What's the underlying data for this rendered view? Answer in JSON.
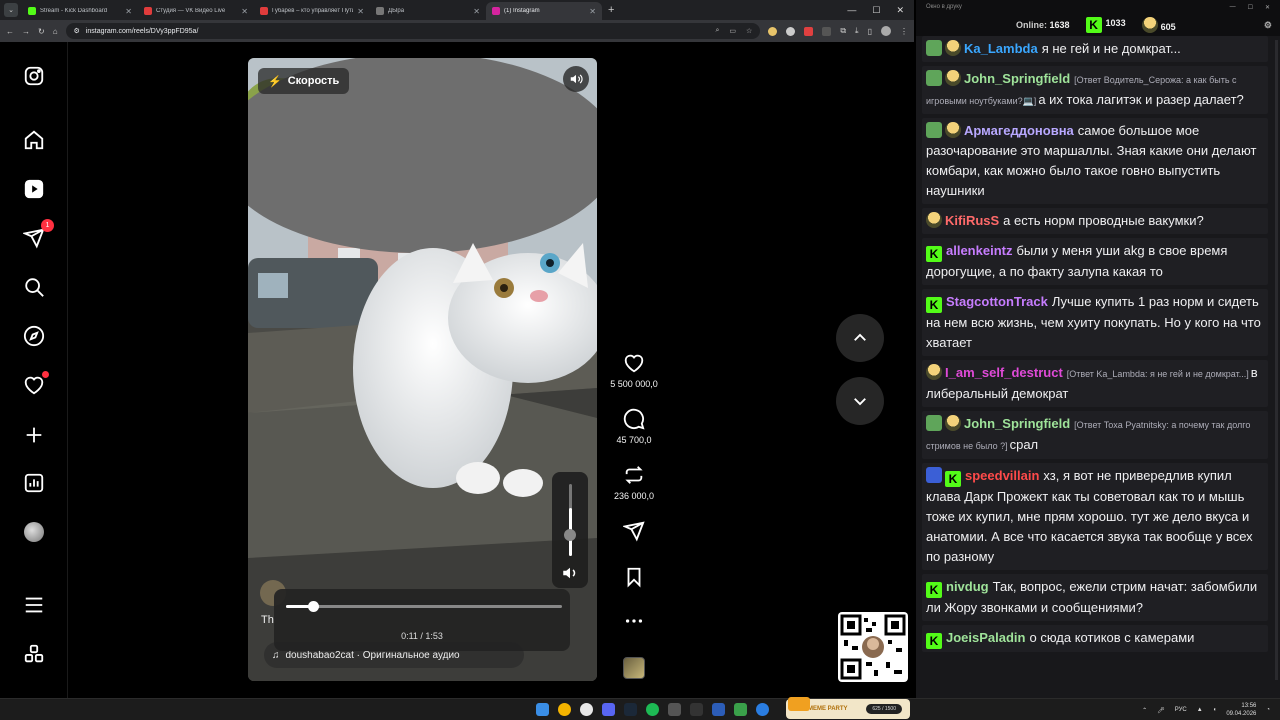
{
  "browser": {
    "tabs": [
      {
        "title": "Stream - Kick Dashboard",
        "color": "#53fc18",
        "active": false
      },
      {
        "title": "Студия — VK Видео Live",
        "color": "#e03c3c",
        "active": false
      },
      {
        "title": "Губарев – кто управляет Пути",
        "color": "#e03c3c",
        "active": false
      },
      {
        "title": "ДЫра",
        "color": "#777777",
        "active": false
      },
      {
        "title": "(1) Instagram",
        "color": "#d6249f",
        "active": true
      }
    ],
    "url": "instagram.com/reels/DVy3ppFD95a/"
  },
  "reel": {
    "speed_label": "Скорость",
    "time": "0:11 / 1:53",
    "progress": 0.097,
    "volume": 0.66,
    "caption_fragment": "Th",
    "audio": "doushabao2cat · Оригинальное аудио",
    "likes": "5 500 000,0",
    "comments": "45 700,0",
    "reposts": "236 000,0"
  },
  "sidebar": {
    "notifications_badge": "1"
  },
  "chat": {
    "title": "Окно в друку",
    "online_label": "Online:",
    "online": "1638",
    "kick_count": "1033",
    "emote_count": "605",
    "messages": [
      {
        "user": "Ka_Lambda",
        "color": "#3aa7ff",
        "text": "я не гей и не домкрат...",
        "reply": "",
        "badges": [
          "sub",
          "emote"
        ]
      },
      {
        "user": "John_Springfield",
        "color": "#9fe39a",
        "text": "а их тока лагитэк и разер далает?",
        "reply": "[Ответ Водитель_Серожа: а как быть с игровыми ноутбуками?💻]",
        "badges": [
          "sub",
          "emote"
        ]
      },
      {
        "user": "Армагеддоновна",
        "color": "#b8a8ff",
        "text": "самое большое мое разочарование это маршаллы. Зная какие они делают комбари, как можно было такое говно выпустить наушники",
        "reply": "",
        "badges": [
          "sub",
          "emote"
        ]
      },
      {
        "user": "KifiRusS",
        "color": "#ff6a6a",
        "text": "а есть норм проводные вакумки?",
        "reply": "",
        "badges": [
          "emote"
        ]
      },
      {
        "user": "allenkeintz",
        "color": "#c77dff",
        "text": "были у меня уши akg в свое время дорогущие, а по факту залупа какая то",
        "reply": "",
        "badges": [
          "kick"
        ]
      },
      {
        "user": "StagcottonTrack",
        "color": "#c77dff",
        "text": "Лучше купить 1 раз норм и сидеть на нем всю жизнь, чем хуиту покупать. Но у кого на что хватает",
        "reply": "",
        "badges": [
          "kick"
        ]
      },
      {
        "user": "I_am_self_destruct",
        "color": "#e04ad8",
        "text": "в либеральный демократ",
        "reply": "[Ответ Ka_Lambda: я не гей и не домкрат...]",
        "badges": [
          "emote"
        ]
      },
      {
        "user": "John_Springfield",
        "color": "#9fe39a",
        "text": "срал",
        "reply": "[Ответ Toxa Pyatnitsky: а почему так долго стримов не было ?]",
        "badges": [
          "sub",
          "emote"
        ]
      },
      {
        "user": "speedvillain",
        "color": "#ff4a4a",
        "text": "хз, я вот не привередлив купил клава Дарк Прожект как ты советовал как то и мышь тоже их купил, мне прям хорошо. тут же дело вкуса и анатомии. А все что касается звука так вообще у всех по разному",
        "reply": "",
        "badges": [
          "sword",
          "kick"
        ]
      },
      {
        "user": "nivdug",
        "color": "#9fe39a",
        "text": "Так, вопрос, ежели стрим начат: забомбили ли Жору звонками и сообщениями?",
        "reply": "",
        "badges": [
          "kick"
        ]
      },
      {
        "user": "JoeisPaladin",
        "color": "#9fe39a",
        "text": "о сюда котиков с камерами",
        "reply": "",
        "badges": [
          "kick"
        ]
      }
    ]
  },
  "taskbar": {
    "meme_label": "MEME PARTY",
    "meme_progress": "625 / 1500",
    "lang": "РУС",
    "time": "13:56",
    "date": "09.04.2026"
  }
}
